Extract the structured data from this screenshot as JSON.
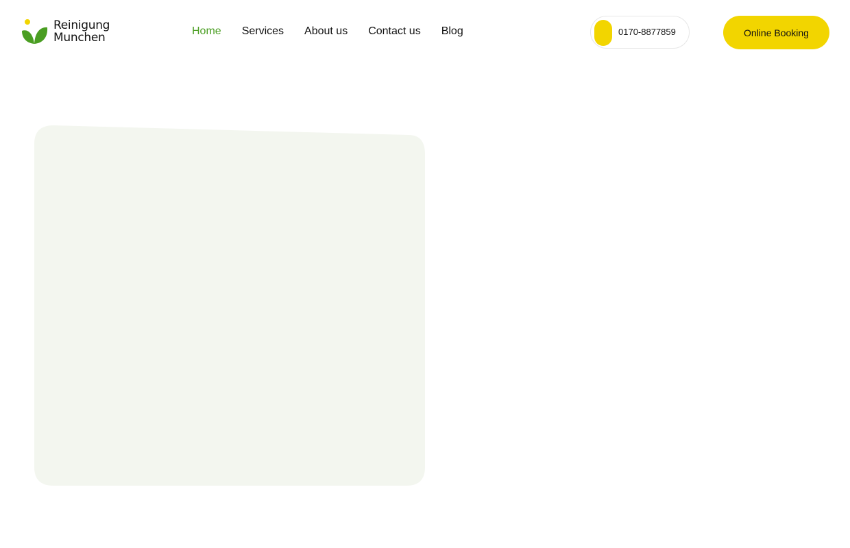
{
  "header": {
    "logo": {
      "line1": "Reinigung",
      "line2": "Munchen",
      "leaf_color": "#4a9e22",
      "dot_color": "#f2d500"
    },
    "nav": [
      {
        "label": "Home",
        "active": true
      },
      {
        "label": "Services",
        "active": false
      },
      {
        "label": "About us",
        "active": false
      },
      {
        "label": "Contact us",
        "active": false
      },
      {
        "label": "Blog",
        "active": false
      }
    ],
    "phone": {
      "number": "0170-8877859",
      "icon": "phone-icon"
    },
    "booking_label": "Online Booking"
  },
  "colors": {
    "accent_yellow": "#f2d500",
    "nav_active_green": "#4a9e22",
    "card_background": "#f3f6ef",
    "text": "#111111"
  },
  "hero": {
    "card": "image-placeholder"
  }
}
